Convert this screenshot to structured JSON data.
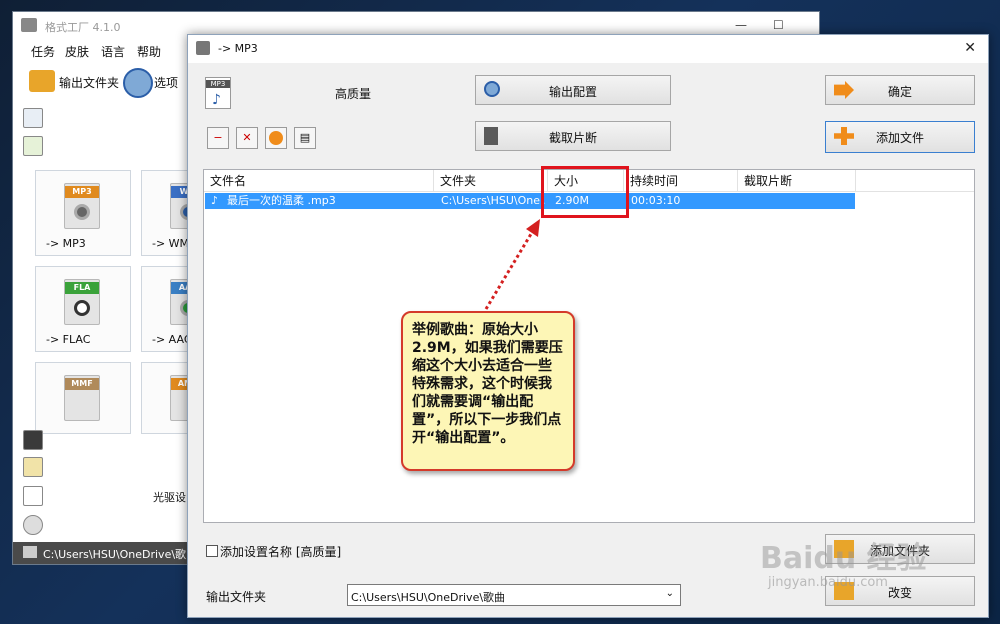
{
  "back_window": {
    "title": "格式工厂 4.1.0",
    "menu": [
      "任务",
      "皮肤",
      "语言",
      "帮助"
    ],
    "toolbar": {
      "output_folder": "输出文件夹",
      "options": "选项"
    },
    "tiles": [
      {
        "badge": "MP3",
        "label": "-> MP3"
      },
      {
        "badge": "WM",
        "label": "-> WM"
      },
      {
        "badge": "FLA",
        "label": "-> FLAC"
      },
      {
        "badge": "AAC",
        "label": "-> AAC"
      },
      {
        "badge": "MMF",
        "label": ""
      },
      {
        "badge": "AMR",
        "label": ""
      }
    ],
    "optical": "光驱设",
    "status_path": "C:\\Users\\HSU\\OneDrive\\歌曲"
  },
  "dialog": {
    "title": "-> MP3",
    "quality": "高质量",
    "buttons": {
      "output_config": "输出配置",
      "clip": "截取片断",
      "ok": "确定",
      "add_file": "添加文件",
      "add_folder": "添加文件夹",
      "change": "改变"
    },
    "columns": [
      "文件名",
      "文件夹",
      "大小",
      "持续时间",
      "截取片断"
    ],
    "rows": [
      {
        "name": "最后一次的温柔 .mp3",
        "folder": "C:\\Users\\HSU\\One...",
        "size": "2.90M",
        "duration": "00:03:10",
        "clip": ""
      }
    ],
    "add_setting_label": "添加设置名称",
    "add_setting_value": "[高质量]",
    "output_folder_label": "输出文件夹",
    "output_folder_value": "C:\\Users\\HSU\\OneDrive\\歌曲"
  },
  "annotation": {
    "text": "举例歌曲：原始大小2.9M，如果我们需要压缩这个大小去适合一些特殊需求，这个时候我们就需要调“输出配置”，所以下一步我们点开“输出配置”。"
  },
  "watermark": {
    "brand": "Baidu 经验",
    "url": "jingyan.baidu.com"
  },
  "colors": {
    "selection": "#3399ff",
    "highlight": "#e0141d",
    "callout_bg": "#fdf6b6",
    "accent_orange": "#f08c1a"
  }
}
